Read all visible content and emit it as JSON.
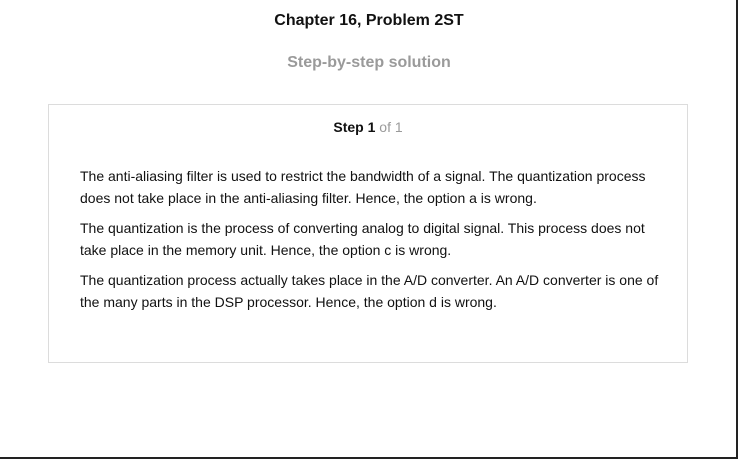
{
  "header": {
    "chapter_title": "Chapter 16, Problem 2ST",
    "subtitle": "Step-by-step solution"
  },
  "step": {
    "label": "Step",
    "number": "1",
    "of_total": "of 1",
    "paragraphs": [
      "The anti-aliasing filter is used to restrict the bandwidth of a signal. The quantization process does not take place in the anti-aliasing filter. Hence, the option a is wrong.",
      "The quantization is the process of converting analog to digital signal. This process does not take place in the memory unit. Hence, the option c is wrong.",
      "The quantization process actually takes place in the A/D converter. An A/D converter is one of the many parts in the DSP processor. Hence, the option d is wrong."
    ]
  }
}
